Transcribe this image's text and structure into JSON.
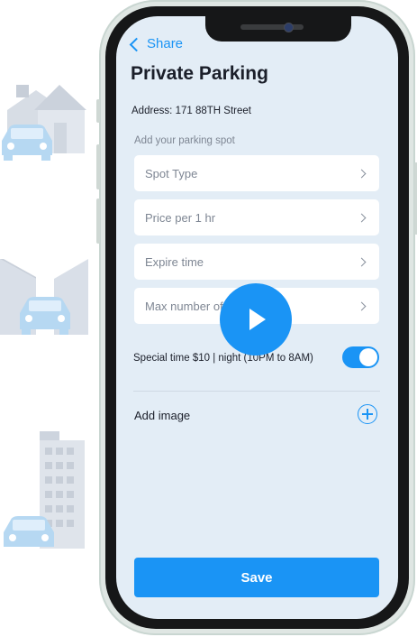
{
  "nav": {
    "back_label": "Share"
  },
  "page": {
    "title": "Private Parking",
    "address": "Address: 171 88TH Street",
    "section_label": "Add your parking spot"
  },
  "fields": [
    {
      "label": "Spot Type"
    },
    {
      "label": "Price per 1 hr"
    },
    {
      "label": "Expire time"
    },
    {
      "label": "Max number of"
    }
  ],
  "special_time": {
    "label": "Special time $10 | night (10PM to 8AM)",
    "enabled": true
  },
  "add_image": {
    "label": "Add image"
  },
  "save_label": "Save",
  "icons": {
    "back": "chevron-left-icon",
    "field_arrow": "chevron-right-icon",
    "add": "plus-circle-icon",
    "play": "play-icon"
  },
  "colors": {
    "accent": "#1a94f5",
    "screen_bg": "#e3edf6",
    "text": "#1b1f2a",
    "muted": "#7e8693"
  }
}
